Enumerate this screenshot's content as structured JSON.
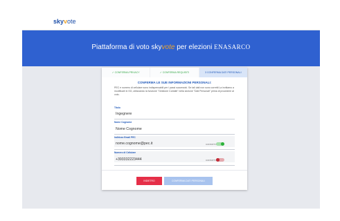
{
  "header": {
    "logo": {
      "part1": "sky",
      "part2": "v",
      "part3": "ote"
    }
  },
  "hero": {
    "title_prefix": "Piattaforma di voto sky",
    "title_accent": "vote",
    "title_mid": " per elezioni ",
    "title_brand": "ENASARCO"
  },
  "steps": [
    {
      "label": "✓ CONFERMA PRIVACY"
    },
    {
      "label": "✓ CONFERMA REQUISITI"
    },
    {
      "label": "3 CONFERMA DATI PERSONALI"
    }
  ],
  "form": {
    "title": "CONFERMA LE SUE INFORMAZIONI PERSONALI:",
    "description": "PEC e numero di cellulare sono indispensabili per i passi successivi. Se tali dati non sono corretti La invitiamo a modificarli in SG, utilizzando la funzione \"Gestione Contatti\" nella sezione \"Dati Personali\" prima di procedere al voto.",
    "fields": [
      {
        "label": "Titolo",
        "value": "Ingegnere"
      },
      {
        "label": "Nome Cognome",
        "value": "Nome Cognome"
      },
      {
        "label": "Indirizzo Email PEC",
        "value": "nome.cognome@pec.it",
        "contact_label": "CONTATTO PEC",
        "toggle": "on"
      },
      {
        "label": "Numero di Cellulare",
        "value": "+393332223444",
        "contact_label": "CONTATTO SMS",
        "toggle": "off"
      }
    ]
  },
  "actions": {
    "back_label": "INDIETRO",
    "confirm_label": "CONFERMA DATI PERSONALI"
  },
  "colors": {
    "primary": "#2f61d0",
    "accent": "#f0a528",
    "danger": "#e52f48",
    "success": "#2db13b"
  }
}
